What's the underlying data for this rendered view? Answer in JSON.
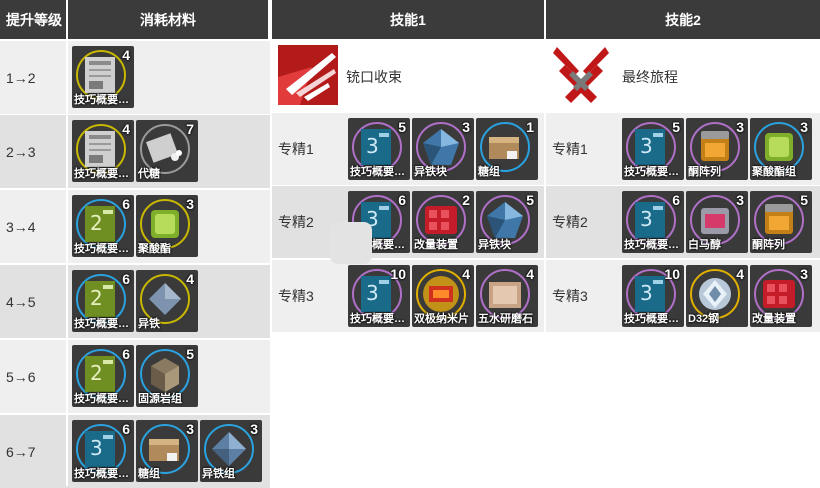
{
  "headers": {
    "level": "提升等级",
    "materials": "消耗材料",
    "skill1": "技能1",
    "skill2": "技能2"
  },
  "levels": [
    {
      "label": "1→2",
      "items": [
        {
          "name": "技巧概要…",
          "count": "4",
          "ring": "#c8b800",
          "art": "book-1"
        }
      ]
    },
    {
      "label": "2→3",
      "items": [
        {
          "name": "技巧概要…",
          "count": "4",
          "ring": "#c8b800",
          "art": "book-1"
        },
        {
          "name": "代糖",
          "count": "7",
          "ring": "#9a9a9a",
          "art": "sugar-sub"
        }
      ]
    },
    {
      "label": "3→4",
      "items": [
        {
          "name": "技巧概要…",
          "count": "6",
          "ring": "#2aa2e0",
          "art": "book-2"
        },
        {
          "name": "聚酸酯",
          "count": "3",
          "ring": "#c8b800",
          "art": "polyester"
        }
      ]
    },
    {
      "label": "4→5",
      "items": [
        {
          "name": "技巧概要…",
          "count": "6",
          "ring": "#2aa2e0",
          "art": "book-2"
        },
        {
          "name": "异铁",
          "count": "4",
          "ring": "#c8b800",
          "art": "orirock-iron"
        }
      ]
    },
    {
      "label": "5→6",
      "items": [
        {
          "name": "技巧概要…",
          "count": "6",
          "ring": "#2aa2e0",
          "art": "book-2"
        },
        {
          "name": "固源岩组",
          "count": "5",
          "ring": "#2aa2e0",
          "art": "orirock-cube"
        }
      ]
    },
    {
      "label": "6→7",
      "items": [
        {
          "name": "技巧概要…",
          "count": "6",
          "ring": "#2aa2e0",
          "art": "book-3"
        },
        {
          "name": "糖组",
          "count": "3",
          "ring": "#2aa2e0",
          "art": "sugar-pack"
        },
        {
          "name": "异铁组",
          "count": "3",
          "ring": "#2aa2e0",
          "art": "iron-pack"
        }
      ]
    }
  ],
  "skill1": {
    "name": "铳口收束",
    "masteries": [
      {
        "label": "专精1",
        "items": [
          {
            "name": "技巧概要…",
            "count": "5",
            "ring": "#b070c8",
            "art": "book-3"
          },
          {
            "name": "异铁块",
            "count": "3",
            "ring": "#b070c8",
            "art": "iron-block"
          },
          {
            "name": "糖组",
            "count": "1",
            "ring": "#2aa2e0",
            "art": "sugar-pack"
          }
        ]
      },
      {
        "label": "专精2",
        "items": [
          {
            "name": "技巧概要…",
            "count": "6",
            "ring": "#b070c8",
            "art": "book-3"
          },
          {
            "name": "改量装置",
            "count": "2",
            "ring": "#b070c8",
            "art": "device"
          },
          {
            "name": "异铁块",
            "count": "5",
            "ring": "#b070c8",
            "art": "iron-block"
          }
        ]
      },
      {
        "label": "专精3",
        "items": [
          {
            "name": "技巧概要…",
            "count": "10",
            "ring": "#b070c8",
            "art": "book-3"
          },
          {
            "name": "双极纳米片",
            "count": "4",
            "ring": "#e0b000",
            "art": "nanoflake"
          },
          {
            "name": "五水研磨石",
            "count": "4",
            "ring": "#b070c8",
            "art": "grindstone"
          }
        ]
      }
    ]
  },
  "skill2": {
    "name": "最终旅程",
    "masteries": [
      {
        "label": "专精1",
        "items": [
          {
            "name": "技巧概要…",
            "count": "5",
            "ring": "#b070c8",
            "art": "book-3"
          },
          {
            "name": "酮阵列",
            "count": "3",
            "ring": "#b070c8",
            "art": "ketone"
          },
          {
            "name": "聚酸酯组",
            "count": "3",
            "ring": "#2aa2e0",
            "art": "polyester"
          }
        ]
      },
      {
        "label": "专精2",
        "items": [
          {
            "name": "技巧概要…",
            "count": "6",
            "ring": "#b070c8",
            "art": "book-3"
          },
          {
            "name": "白马醇",
            "count": "3",
            "ring": "#b070c8",
            "art": "alcohol"
          },
          {
            "name": "酮阵列",
            "count": "5",
            "ring": "#b070c8",
            "art": "ketone"
          }
        ]
      },
      {
        "label": "专精3",
        "items": [
          {
            "name": "技巧概要…",
            "count": "10",
            "ring": "#b070c8",
            "art": "book-3"
          },
          {
            "name": "D32钢",
            "count": "4",
            "ring": "#e0b000",
            "art": "d32"
          },
          {
            "name": "改量装置",
            "count": "3",
            "ring": "#b070c8",
            "art": "device"
          }
        ]
      }
    ]
  },
  "colors": {
    "header": "#3b3b3b",
    "row_light": "#efefef",
    "row_dark": "#e1e1e1",
    "cell_tint": "#e6e6e6"
  }
}
